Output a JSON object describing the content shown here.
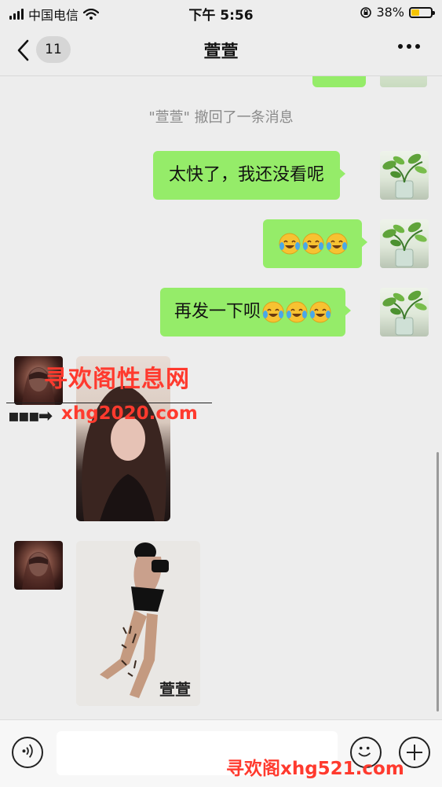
{
  "status_bar": {
    "carrier": "中国电信",
    "time": "下午 5:56",
    "battery": "38%",
    "battery_level": 0.38
  },
  "nav": {
    "unread_count": "11",
    "title": "萱萱"
  },
  "chat": {
    "recall_notice": "\"萱萱\" 撤回了一条消息",
    "messages": [
      {
        "sender": "me",
        "text": "太快了，我还没看呢"
      },
      {
        "sender": "me",
        "text": "",
        "emoji": [
          "tears-of-joy-emoji",
          "tears-of-joy-emoji",
          "tears-of-joy-emoji"
        ]
      },
      {
        "sender": "me",
        "text": "再发一下呗",
        "emoji": [
          "tears-of-joy-emoji",
          "tears-of-joy-emoji",
          "tears-of-joy-emoji"
        ]
      },
      {
        "sender": "contact",
        "type": "photo"
      },
      {
        "sender": "contact",
        "type": "photo",
        "caption": "萱萱"
      }
    ]
  },
  "watermarks": {
    "site_name": "寻欢阁性息网",
    "site_url": "xhg2020.com",
    "bottom": "寻欢阁xhg521.com"
  },
  "colors": {
    "bubble_green": "#95ec69",
    "background": "#ededed",
    "watermark_red": "#ff3a2e"
  }
}
